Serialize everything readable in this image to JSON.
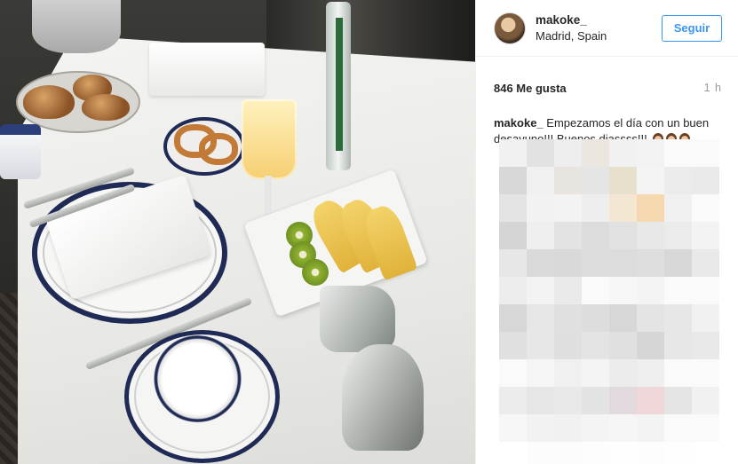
{
  "header": {
    "username": "makoke_",
    "location": "Madrid, Spain",
    "follow_label": "Seguir"
  },
  "meta": {
    "likes": "846 Me gusta",
    "time": "1 h"
  },
  "caption": {
    "username": "makoke_",
    "text": "Empezamos el día con un buen desayuno!!! Buenos diassss!!!"
  },
  "colors": {
    "accent": "#3897f0",
    "text": "#262626",
    "muted": "#999999"
  },
  "icons": {
    "avatar": "profile-avatar",
    "emoji": "woman-emoji"
  },
  "blurred_comments": [
    [
      "#f1f1f1",
      "#e2e2e2",
      "#eeeeee",
      "#ebe7e0",
      "#f1f1f1",
      "#f3f3f3",
      "#fafafa",
      "#fafafa"
    ],
    [
      "#d8d8d8",
      "#f0f0f0",
      "#e8e4e0",
      "#e5e5e5",
      "#e7e0cd",
      "#f4f4f4",
      "#ececec",
      "#eaeaea"
    ],
    [
      "#e4e4e4",
      "#f2f2f2",
      "#f3f3f3",
      "#eeeeee",
      "#f3e6d2",
      "#f6d8b0",
      "#f0f0f0",
      "#fafafa"
    ],
    [
      "#d5d5d5",
      "#efefef",
      "#e3e3e3",
      "#dcdcdc",
      "#e1e1e1",
      "#e8e8e8",
      "#ebebeb",
      "#f3f3f3"
    ],
    [
      "#e7e7e7",
      "#dadada",
      "#d9d9d9",
      "#dddddd",
      "#dcdcdc",
      "#dedede",
      "#d8d8d8",
      "#e9e9e9"
    ],
    [
      "#ededed",
      "#f3f3f3",
      "#eaeaea",
      "#fafafa",
      "#f7f7f7",
      "#f4f4f4",
      "#fafafa",
      "#fafafa"
    ],
    [
      "#d7d7d7",
      "#e6e6e6",
      "#e0e0e0",
      "#dddddd",
      "#d7d7d7",
      "#e4e4e4",
      "#e7e7e7",
      "#f1f1f1"
    ],
    [
      "#e0e0e0",
      "#e7e7e7",
      "#dfdfdf",
      "#e4e4e4",
      "#e0e0e0",
      "#d6d6d6",
      "#e7e7e7",
      "#e9e9e9"
    ],
    [
      "#fafafa",
      "#f5f5f5",
      "#f0f0f0",
      "#f4f4f4",
      "#ececec",
      "#efefef",
      "#fafafa",
      "#fafafa"
    ],
    [
      "#ececec",
      "#e6e6e6",
      "#e9e9e9",
      "#e3e3e3",
      "#e2d9df",
      "#f0d8da",
      "#e5e5e5",
      "#f1f1f1"
    ],
    [
      "#f7f7f7",
      "#f2f2f2",
      "#f1f1f1",
      "#f4f4f4",
      "#f6f6f6",
      "#f3f3f3",
      "#fafafa",
      "#fafafa"
    ],
    [
      "#ffffff",
      "#fcfcfc",
      "#fcfcfc",
      "#fdfdfd",
      "#fefefe",
      "#fdfdfd",
      "#fefefe",
      "#ffffff"
    ]
  ]
}
